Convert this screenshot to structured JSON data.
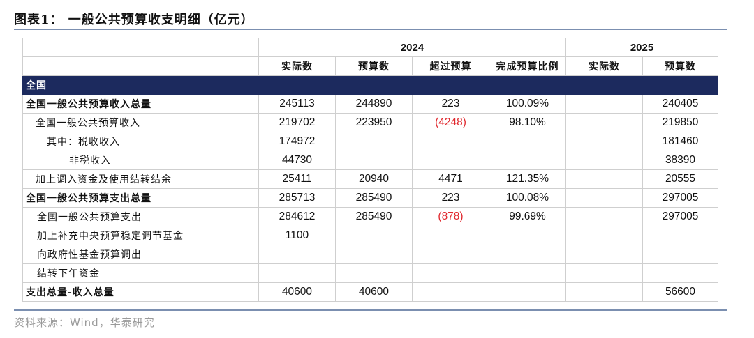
{
  "title": "图表1：  一般公共预算收支明细（亿元）",
  "years": {
    "y2024": "2024",
    "y2025": "2025"
  },
  "headers": {
    "c1": "实际数",
    "c2": "预算数",
    "c3": "超过预算",
    "c4": "完成预算比例",
    "c5": "实际数",
    "c6": "预算数"
  },
  "section_label": "全国",
  "rows": [
    {
      "label": "全国一般公共预算收入总量",
      "v": [
        "245113",
        "244890",
        "223",
        "100.09%",
        "",
        "240405"
      ]
    },
    {
      "label": "全国一般公共预算收入",
      "v": [
        "219702",
        "223950",
        "(4248)",
        "98.10%",
        "",
        "219850"
      ]
    },
    {
      "label": "其中：税收收入",
      "v": [
        "174972",
        "",
        "",
        "",
        "",
        "181460"
      ]
    },
    {
      "label": "非税收入",
      "v": [
        "44730",
        "",
        "",
        "",
        "",
        "38390"
      ]
    },
    {
      "label": "加上调入资金及使用结转结余",
      "v": [
        "25411",
        "20940",
        "4471",
        "121.35%",
        "",
        "20555"
      ]
    },
    {
      "label": "全国一般公共预算支出总量",
      "v": [
        "285713",
        "285490",
        "223",
        "100.08%",
        "",
        "297005"
      ]
    },
    {
      "label": "全国一般公共预算支出",
      "v": [
        "284612",
        "285490",
        "(878)",
        "99.69%",
        "",
        "297005"
      ]
    },
    {
      "label": "加上补充中央预算稳定调节基金",
      "v": [
        "1100",
        "",
        "",
        "",
        "",
        ""
      ]
    },
    {
      "label": "向政府性基金预算调出",
      "v": [
        "",
        "",
        "",
        "",
        "",
        ""
      ]
    },
    {
      "label": "结转下年资金",
      "v": [
        "",
        "",
        "",
        "",
        "",
        ""
      ]
    },
    {
      "label": "支出总量-收入总量",
      "v": [
        "40600",
        "40600",
        "",
        "",
        "",
        "56600"
      ]
    }
  ],
  "colors": {
    "section_bg": "#1c2a5e",
    "negative": "#e0282e",
    "rule": "#7b8fb0"
  },
  "source": "资料来源：Wind，华泰研究"
}
